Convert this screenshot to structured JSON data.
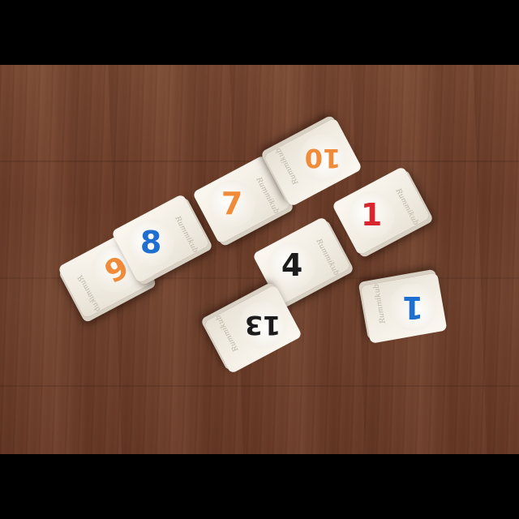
{
  "photo": {
    "description_tiles": [
      {
        "number": "6",
        "color": "#f08b3a",
        "brand": "Rummikub"
      },
      {
        "number": "8",
        "color": "#1f6fd1",
        "brand": "Rummikub"
      },
      {
        "number": "7",
        "color": "#f08b3a",
        "brand": "Rummikub"
      },
      {
        "number": "10",
        "color": "#f08b3a",
        "brand": "Rummikub"
      },
      {
        "number": "1",
        "color": "#d9262e",
        "brand": "Rummikub"
      },
      {
        "number": "4",
        "color": "#1c1c1c",
        "brand": "Rummikub"
      },
      {
        "number": "13",
        "color": "#1c1c1c",
        "brand": "Rummikub"
      },
      {
        "number": "1",
        "color": "#1f6fd1",
        "brand": "Rummikub"
      }
    ]
  },
  "colors": {
    "letterbox": "#000000",
    "table_wood": "#6e3f2b",
    "tile_face": "#f6f2ea"
  }
}
